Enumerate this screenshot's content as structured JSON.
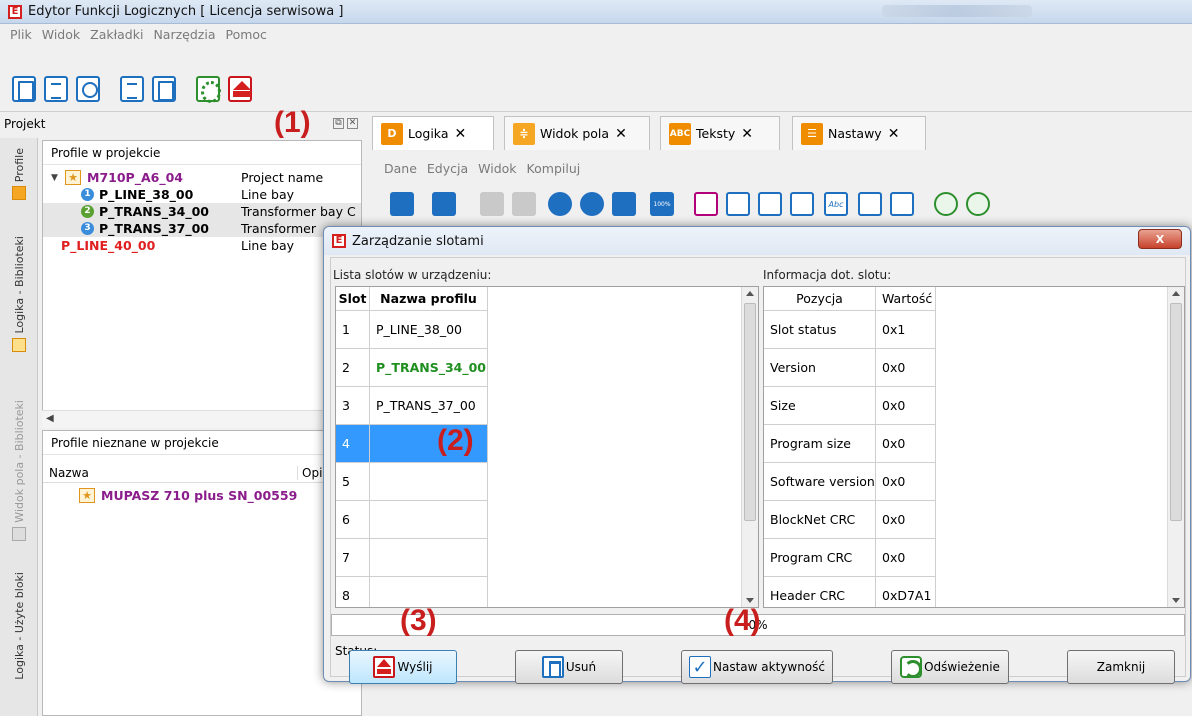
{
  "window": {
    "title": "Edytor Funkcji Logicznych [ Licencja serwisowa ]",
    "menu": [
      "Plik",
      "Widok",
      "Zakładki",
      "Narzędzia",
      "Pomoc"
    ]
  },
  "annotations": [
    "(1)",
    "(2)",
    "(3)",
    "(4)"
  ],
  "project_panel": {
    "title": "Projekt",
    "profiles_title": "Profile w projekcie",
    "tree": [
      {
        "name": "M710P_A6_04",
        "desc": "Project name",
        "color": "#8b1c8b"
      },
      {
        "badge": "1",
        "badge_color": "#3a8ddb",
        "name": "P_LINE_38_00",
        "desc": "Line bay",
        "color": "#000000"
      },
      {
        "badge": "2",
        "badge_color": "#5aa032",
        "name": "P_TRANS_34_00",
        "desc": "Transformer bay C",
        "color": "#000000"
      },
      {
        "badge": "3",
        "badge_color": "#3a8ddb",
        "name": "P_TRANS_37_00",
        "desc": "Transformer",
        "color": "#000000"
      },
      {
        "name": "P_LINE_40_00",
        "desc": "Line bay",
        "color": "#e02020"
      }
    ],
    "unknown_title": "Profile nieznane w projekcie",
    "columns": [
      "Nazwa",
      "Opi"
    ],
    "unknown_items": [
      {
        "name": "MUPASZ 710 plus SN_00559",
        "color": "#8b1c8b"
      }
    ]
  },
  "vertical_tabs": [
    "Profile",
    "Logika - Biblioteki",
    "Widok pola - Biblioteki",
    "Logika - Użyte bloki"
  ],
  "editor": {
    "tabs": [
      {
        "label": "Logika",
        "icon": "D",
        "icon_color": "#f08c00"
      },
      {
        "label": "Widok pola",
        "icon": "≑",
        "icon_color": "#f5a623"
      },
      {
        "label": "Teksty",
        "icon": "ABC",
        "icon_color": "#f08c00"
      },
      {
        "label": "Nastawy",
        "icon": "☰",
        "icon_color": "#f08c00"
      }
    ],
    "menu": [
      "Dane",
      "Edycja",
      "Widok",
      "Kompiluj"
    ],
    "toolbar_zoom_label": "100%",
    "toolbar_abc_label": "Abc"
  },
  "dialog": {
    "title": "Zarządzanie slotami",
    "close": "X",
    "left_label": "Lista slotów w urządzeniu:",
    "right_label": "Informacja dot. slotu:",
    "slot_headers": [
      "Slot",
      "Nazwa profilu"
    ],
    "slots": [
      {
        "slot": "1",
        "name": "P_LINE_38_00",
        "color": "#000000"
      },
      {
        "slot": "2",
        "name": "P_TRANS_34_00",
        "color": "#1f8f1f"
      },
      {
        "slot": "3",
        "name": "P_TRANS_37_00",
        "color": "#000000"
      },
      {
        "slot": "4",
        "name": "",
        "color": "#000000"
      },
      {
        "slot": "5",
        "name": "",
        "color": "#000000"
      },
      {
        "slot": "6",
        "name": "",
        "color": "#000000"
      },
      {
        "slot": "7",
        "name": "",
        "color": "#000000"
      },
      {
        "slot": "8",
        "name": "",
        "color": "#000000"
      }
    ],
    "info_headers": [
      "Pozycja",
      "Wartość"
    ],
    "info_rows": [
      {
        "pos": "Slot status",
        "val": "0x1"
      },
      {
        "pos": "Version",
        "val": "0x0"
      },
      {
        "pos": "Size",
        "val": "0x0"
      },
      {
        "pos": "Program size",
        "val": "0x0"
      },
      {
        "pos": "Software version",
        "val": "0x0"
      },
      {
        "pos": "BlockNet CRC",
        "val": "0x0"
      },
      {
        "pos": "Program CRC",
        "val": "0x0"
      },
      {
        "pos": "Header CRC",
        "val": "0xD7A1"
      }
    ],
    "progress_text": "0%",
    "status_text": "Status: ...",
    "buttons": {
      "send": "Wyślij",
      "delete": "Usuń",
      "set_active": "Nastaw aktywność",
      "refresh": "Odświeżenie",
      "close": "Zamknij"
    }
  }
}
